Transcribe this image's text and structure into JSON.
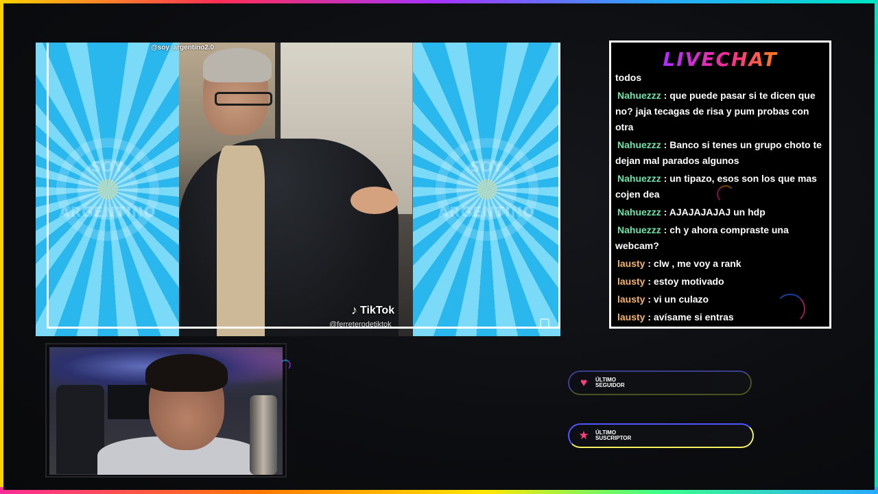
{
  "colors": {
    "chat_user_green": "#6fe3a8",
    "chat_user_orange": "#f3b36b",
    "heart": "#ff3d7f",
    "star": "#ff3d7f"
  },
  "video": {
    "clip_username": "@soy_argentino2.0",
    "watermark_top": "SOY",
    "watermark_bottom": "ARGENTINO",
    "tiktok_label": "TikTok",
    "tiktok_handle": "@ferreterodetiktok"
  },
  "chat": {
    "title": "LIVECHAT",
    "continuation": "todos",
    "messages": [
      {
        "user": "Nahuezzz",
        "color": "green",
        "text": "que puede pasar si te dicen que no? jaja tecagas de risa y pum probas con otra"
      },
      {
        "user": "Nahuezzz",
        "color": "green",
        "text": "Banco si tenes un grupo choto te dejan mal parados algunos"
      },
      {
        "user": "Nahuezzz",
        "color": "green",
        "text": "un tipazo, esos son los que mas cojen dea"
      },
      {
        "user": "Nahuezzz",
        "color": "green",
        "text": "AJAJAJAJAJ un hdp"
      },
      {
        "user": "Nahuezzz",
        "color": "green",
        "text": "ch y ahora compraste una webcam?"
      },
      {
        "user": "lausty",
        "color": "orange",
        "text": "clw , me voy a rank"
      },
      {
        "user": "lausty",
        "color": "orange",
        "text": "estoy motivado"
      },
      {
        "user": "lausty",
        "color": "orange",
        "text": "vi un culazo"
      },
      {
        "user": "lausty",
        "color": "orange",
        "text": "avísame si entras"
      }
    ]
  },
  "alerts": {
    "follower": {
      "icon": "heart-icon",
      "line1": "ÚLTIMO",
      "line2": "SEGUIDOR"
    },
    "subscriber": {
      "icon": "star-icon",
      "line1": "ÚLTIMO",
      "line2": "SUSCRIPTOR"
    }
  }
}
